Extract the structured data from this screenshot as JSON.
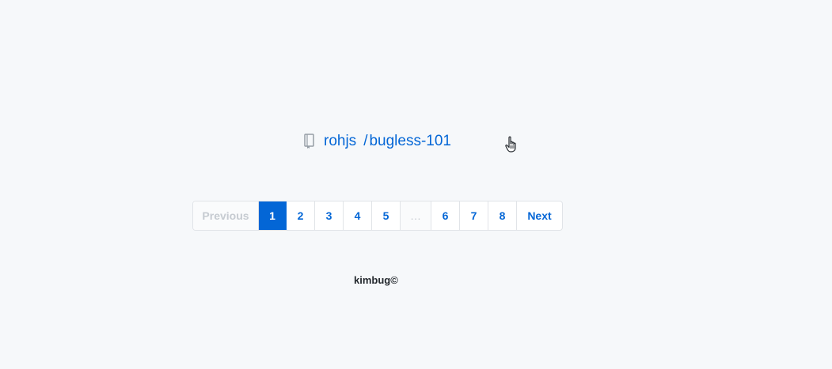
{
  "repo": {
    "icon": "repo-book-icon",
    "owner": "rohjs",
    "separator": "/",
    "name": "bugless-101"
  },
  "pagination": {
    "previous_label": "Previous",
    "next_label": "Next",
    "current_page": "1",
    "pages_before_gap": [
      "2",
      "3",
      "4",
      "5"
    ],
    "gap": "…",
    "pages_after_gap": [
      "6",
      "7",
      "8"
    ]
  },
  "footer": {
    "text": "kimbug©"
  },
  "colors": {
    "link": "#0366d6",
    "background": "#f6f8fa",
    "current_page_bg": "#0366d6",
    "disabled_text": "#c6cbd1"
  }
}
